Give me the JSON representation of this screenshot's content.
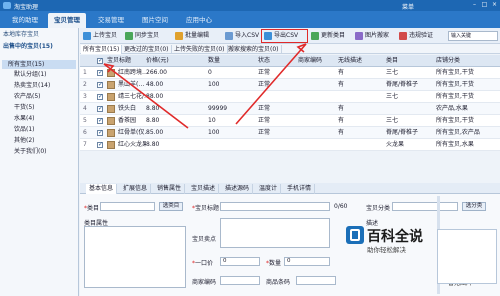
{
  "app": {
    "title": "淘宝助理",
    "user": "菜单"
  },
  "nav": {
    "tabs": [
      "我的助理",
      "宝贝管理",
      "交易管理",
      "图片空间",
      "应用中心"
    ]
  },
  "sidebar": {
    "header": "本地库存宝贝",
    "section": "出售中的宝贝(15)",
    "items": [
      {
        "label": "所有宝贝(15)",
        "selected": true
      },
      {
        "label": "默认分组(1)"
      },
      {
        "label": "热卖宝贝(14)"
      },
      {
        "label": "农产品(5)"
      },
      {
        "label": "干货(5)"
      },
      {
        "label": "水果(4)"
      },
      {
        "label": "饮品(1)"
      },
      {
        "label": "其他(2)"
      },
      {
        "label": "关于我们(0)"
      }
    ]
  },
  "toolbar": {
    "buttons": [
      "上传宝贝",
      "同步宝贝",
      "批量编辑",
      "导入CSV",
      "导出CSV",
      "更新类目",
      "图片搬家",
      "违规验证"
    ],
    "search_placeholder": "输入关键"
  },
  "filters": [
    "所有宝贝(15)",
    "更改过的宝贝(0)",
    "上传失败的宝贝(0)",
    "搬家搜索的宝贝(0)"
  ],
  "table": {
    "columns": [
      "",
      "宝贝标题",
      "价格(元)",
      "数量",
      "状态",
      "商家编码",
      "无线描述",
      "类目",
      "店铺分类"
    ],
    "rows": [
      {
        "n": "1",
        "checked": true,
        "title": "红南跨境…",
        "price": "266.00",
        "qty": "0",
        "status": "正常",
        "code": "",
        "wireless": "有",
        "cat": "三七",
        "shop": "所有宝贝,干货"
      },
      {
        "n": "2",
        "checked": true,
        "title": "黑山羊(…",
        "price": "48.00",
        "qty": "100",
        "status": "正常",
        "code": "",
        "wireless": "有",
        "cat": "脊尾/脊椎子",
        "shop": "所有宝贝,干货"
      },
      {
        "n": "3",
        "checked": true,
        "title": "靖三七花/…",
        "price": "88.00",
        "qty": "",
        "status": "",
        "code": "",
        "wireless": "",
        "cat": "三七",
        "shop": "所有宝贝,干货"
      },
      {
        "n": "4",
        "checked": true,
        "title": "铁头白",
        "price": "8.80",
        "qty": "99999",
        "status": "正常",
        "code": "",
        "wireless": "有",
        "cat": "",
        "shop": "农产品,水果"
      },
      {
        "n": "5",
        "checked": true,
        "title": "香茶园",
        "price": "8.80",
        "qty": "10",
        "status": "正常",
        "code": "",
        "wireless": "有",
        "cat": "三七",
        "shop": "所有宝贝,干货"
      },
      {
        "n": "6",
        "checked": true,
        "title": "红骨单(仅…",
        "price": "85.00",
        "qty": "100",
        "status": "正常",
        "code": "",
        "wireless": "有",
        "cat": "脊尾/脊椎子",
        "shop": "所有宝贝,农产品"
      },
      {
        "n": "7",
        "checked": true,
        "title": "红心火龙果",
        "price": "8.80",
        "qty": "",
        "status": "",
        "code": "",
        "wireless": "",
        "cat": "火龙果",
        "shop": "所有宝贝,水果"
      }
    ]
  },
  "bottom_tabs": [
    "基本信息",
    "扩展信息",
    "销售属性",
    "宝贝描述",
    "描述源码",
    "温度计",
    "手机详情"
  ],
  "form": {
    "category_label": "类目",
    "choose_category": "选类目",
    "item_props": "类目属性",
    "title_label": "宝贝标题",
    "title_count": "0/60",
    "selling_points": "宝贝卖点",
    "price_label": "一口价",
    "price": "0",
    "qty_label": "数量",
    "qty": "0",
    "code_label": "商家编码",
    "barcode_label": "商品条码",
    "shop_cat_label": "宝贝分类",
    "shop_cat_btn": "选分类",
    "desc_label": "描述",
    "no_image": "暂无图片"
  },
  "watermark": {
    "title": "百科全说",
    "subtitle": "助你轻松解决"
  }
}
